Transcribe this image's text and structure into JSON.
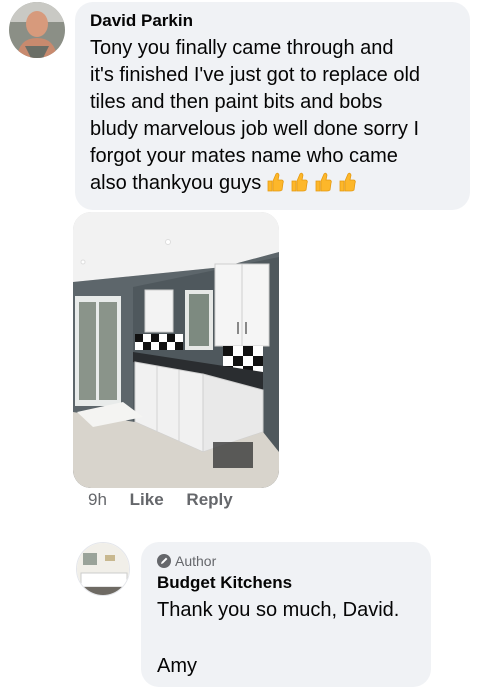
{
  "comment": {
    "author": "David Parkin",
    "lines": [
      "Tony you finally came through and",
      "it's finished I've just got to replace old",
      "tiles and then paint bits and bobs",
      "bludy marvelous job well done sorry I",
      "forgot your mates name who came",
      "also thankyou guys"
    ],
    "emoji": [
      "thumbs-up-icon",
      "thumbs-up-icon",
      "thumbs-up-icon",
      "thumbs-up-icon"
    ],
    "photo": "kitchen-photo"
  },
  "actions": {
    "time": "9h",
    "like_label": "Like",
    "reply_label": "Reply"
  },
  "reply": {
    "badge": "Author",
    "author": "Budget Kitchens",
    "text": "Thank you so much, David.",
    "signature": "Amy"
  },
  "colors": {
    "bubble": "#f0f2f5",
    "meta_text": "#65676b",
    "emoji": "#fdb72a"
  }
}
